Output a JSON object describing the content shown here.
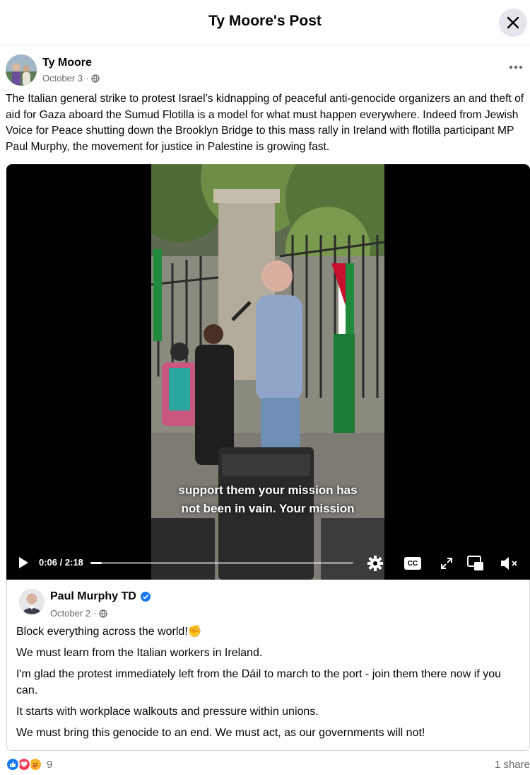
{
  "header": {
    "title": "Ty Moore's Post"
  },
  "post": {
    "author": "Ty Moore",
    "date": "October 3",
    "separator": "·",
    "text": "The Italian general strike to protest Israel’s kidnapping of peaceful anti-genocide organizers an and theft of aid for Gaza aboard the Sumud Flotilla is a model for what must happen everywhere. Indeed from Jewish Voice for Peace shutting down the Brooklyn Bridge to this mass rally in Ireland with flotilla participant MP Paul Murphy, the movement for justice in Palestine is growing fast."
  },
  "video": {
    "subtitle_line1": "support them your mission has",
    "subtitle_line2": "not been in vain. Your mission",
    "time": "0:06 / 2:18",
    "progress_fraction": 0.043,
    "cc_label": "CC",
    "icons": [
      "play-icon",
      "settings-icon",
      "closed-captions-icon",
      "fullscreen-icon",
      "picture-in-picture-icon",
      "muted-icon"
    ]
  },
  "shared_post": {
    "author": "Paul Murphy TD",
    "verified": true,
    "date": "October 2",
    "separator": "·",
    "lines": [
      "Block everything across the world!",
      "We must learn from the Italian workers in Ireland.",
      "I'm glad the protest immediately left from the Dáil to march to the port - join them there now if you can.",
      "It starts with workplace walkouts and pressure within unions.",
      "We must bring this genocide to an end. We must act, as our governments will not!"
    ],
    "line1_emoji": "✊"
  },
  "footer": {
    "reaction_count": "9",
    "shares": "1 share",
    "reaction_icons": [
      "like-icon",
      "love-icon",
      "care-icon"
    ]
  },
  "colors": {
    "accent": "#1877f2",
    "love": "#f33e58",
    "care": "#f7b125",
    "secondary_text": "#65676b"
  }
}
